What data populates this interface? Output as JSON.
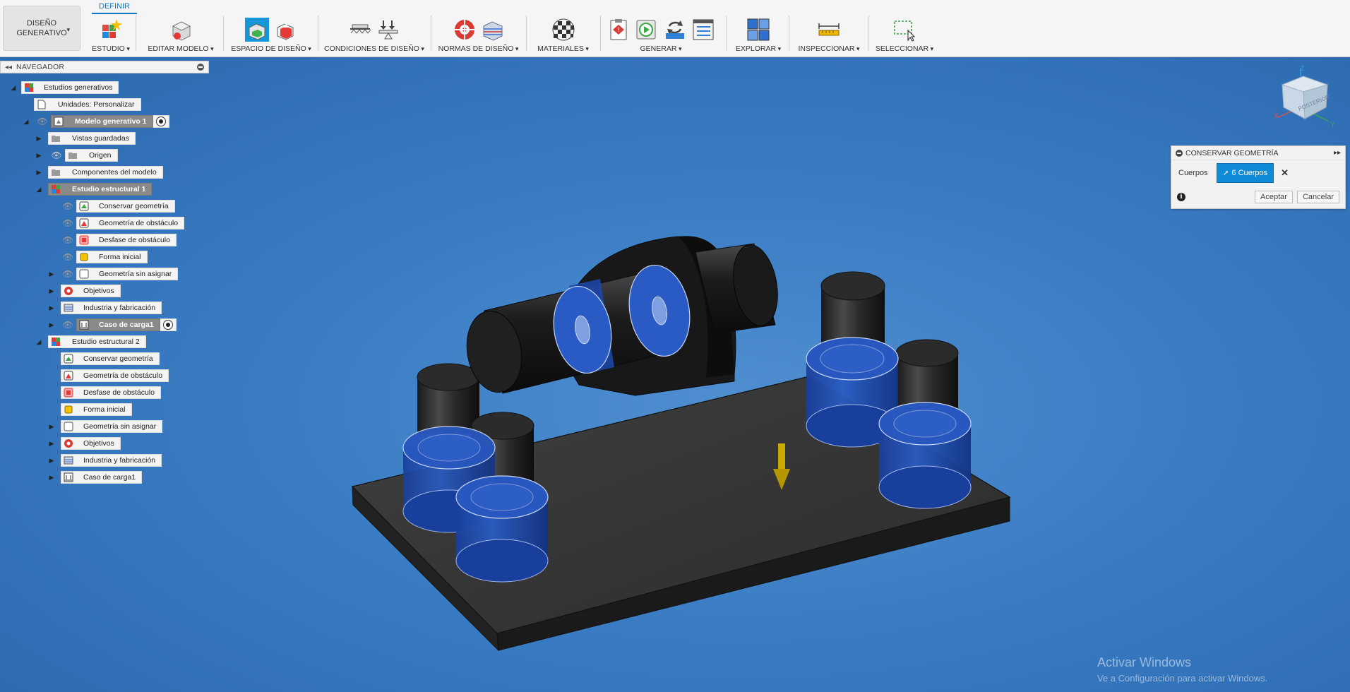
{
  "toolbar": {
    "workspace_label": "DISEÑO\nGENERATIVO",
    "active_tab": "DEFINIR",
    "groups": {
      "estudio": "ESTUDIO",
      "editar_modelo": "EDITAR MODELO",
      "espacio_diseno": "ESPACIO DE DISEÑO",
      "condiciones_diseno": "CONDICIONES DE DISEÑO",
      "normas_diseno": "NORMAS DE DISEÑO",
      "materiales": "MATERIALES",
      "generar": "GENERAR",
      "explorar": "EXPLORAR",
      "inspeccionar": "INSPECCIONAR",
      "seleccionar": "SELECCIONAR"
    }
  },
  "navigator": {
    "title": "NAVEGADOR",
    "items": {
      "root": "Estudios generativos",
      "units": "Unidades: Personalizar",
      "model": "Modelo generativo 1",
      "saved_views": "Vistas guardadas",
      "origin": "Origen",
      "model_components": "Componentes del modelo",
      "study1": "Estudio estructural 1",
      "s1_preserve": "Conservar geometría",
      "s1_obstacle": "Geometría de obstáculo",
      "s1_offset": "Desfase de obstáculo",
      "s1_starting": "Forma inicial",
      "s1_unassigned": "Geometría sin asignar",
      "s1_objectives": "Objetivos",
      "s1_manufacturing": "Industria y fabricación",
      "s1_load": "Caso de carga1",
      "study2": "Estudio estructural 2",
      "s2_preserve": "Conservar geometría",
      "s2_obstacle": "Geometría de obstáculo",
      "s2_offset": "Desfase de obstáculo",
      "s2_starting": "Forma inicial",
      "s2_unassigned": "Geometría sin asignar",
      "s2_objectives": "Objetivos",
      "s2_manufacturing": "Industria y fabricación",
      "s2_load": "Caso de carga1"
    }
  },
  "viewcube": {
    "face_label": "POSTERIOR",
    "axes": {
      "x": "X",
      "y": "Y",
      "z": "Z"
    }
  },
  "preserve_panel": {
    "title": "CONSERVAR GEOMETRÍA",
    "bodies_label": "Cuerpos",
    "selection_label": "6 Cuerpos",
    "ok_label": "Aceptar",
    "cancel_label": "Cancelar"
  },
  "watermark": {
    "line1": "Activar Windows",
    "line2": "Ve a Configuración para activar Windows."
  },
  "colors": {
    "viewport_bg": "#3a7cc4",
    "accent": "#0f8bd8",
    "preserve_blue": "#1e50b4",
    "load_arrow": "#c9a800"
  }
}
